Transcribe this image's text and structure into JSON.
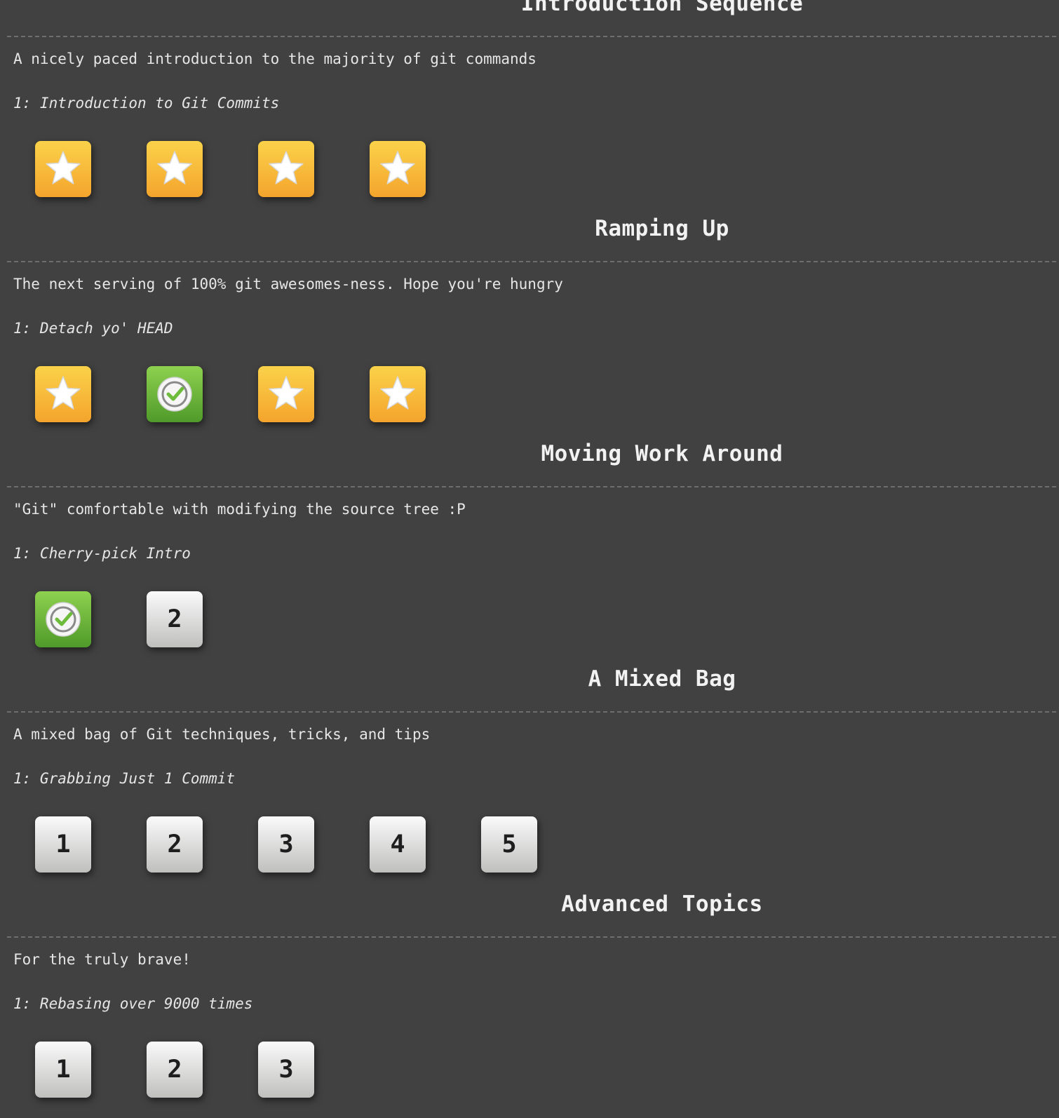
{
  "sections": [
    {
      "title": "Introduction Sequence",
      "description": "A nicely paced introduction to the majority of git commands",
      "level_name": "1: Introduction to Git Commits",
      "levels": [
        {
          "status": "star",
          "icon": "star-icon"
        },
        {
          "status": "star",
          "icon": "star-icon"
        },
        {
          "status": "star",
          "icon": "star-icon"
        },
        {
          "status": "star",
          "icon": "star-icon"
        }
      ]
    },
    {
      "title": "Ramping Up",
      "description": "The next serving of 100% git awesomes-ness. Hope you're hungry",
      "level_name": "1: Detach yo' HEAD",
      "levels": [
        {
          "status": "star",
          "icon": "star-icon"
        },
        {
          "status": "done",
          "icon": "checkmark-icon"
        },
        {
          "status": "star",
          "icon": "star-icon"
        },
        {
          "status": "star",
          "icon": "star-icon"
        }
      ]
    },
    {
      "title": "Moving Work Around",
      "description": "\"Git\" comfortable with modifying the source tree :P",
      "level_name": "1: Cherry-pick Intro",
      "levels": [
        {
          "status": "done",
          "icon": "checkmark-icon"
        },
        {
          "status": "plain",
          "label": "2"
        }
      ]
    },
    {
      "title": "A Mixed Bag",
      "description": "A mixed bag of Git techniques, tricks, and tips",
      "level_name": "1: Grabbing Just 1 Commit",
      "levels": [
        {
          "status": "plain",
          "label": "1"
        },
        {
          "status": "plain",
          "label": "2"
        },
        {
          "status": "plain",
          "label": "3"
        },
        {
          "status": "plain",
          "label": "4"
        },
        {
          "status": "plain",
          "label": "5"
        }
      ]
    },
    {
      "title": "Advanced Topics",
      "description": "For the truly brave!",
      "level_name": "1: Rebasing over 9000 times",
      "levels": [
        {
          "status": "plain",
          "label": "1"
        },
        {
          "status": "plain",
          "label": "2"
        },
        {
          "status": "plain",
          "label": "3"
        }
      ]
    }
  ]
}
